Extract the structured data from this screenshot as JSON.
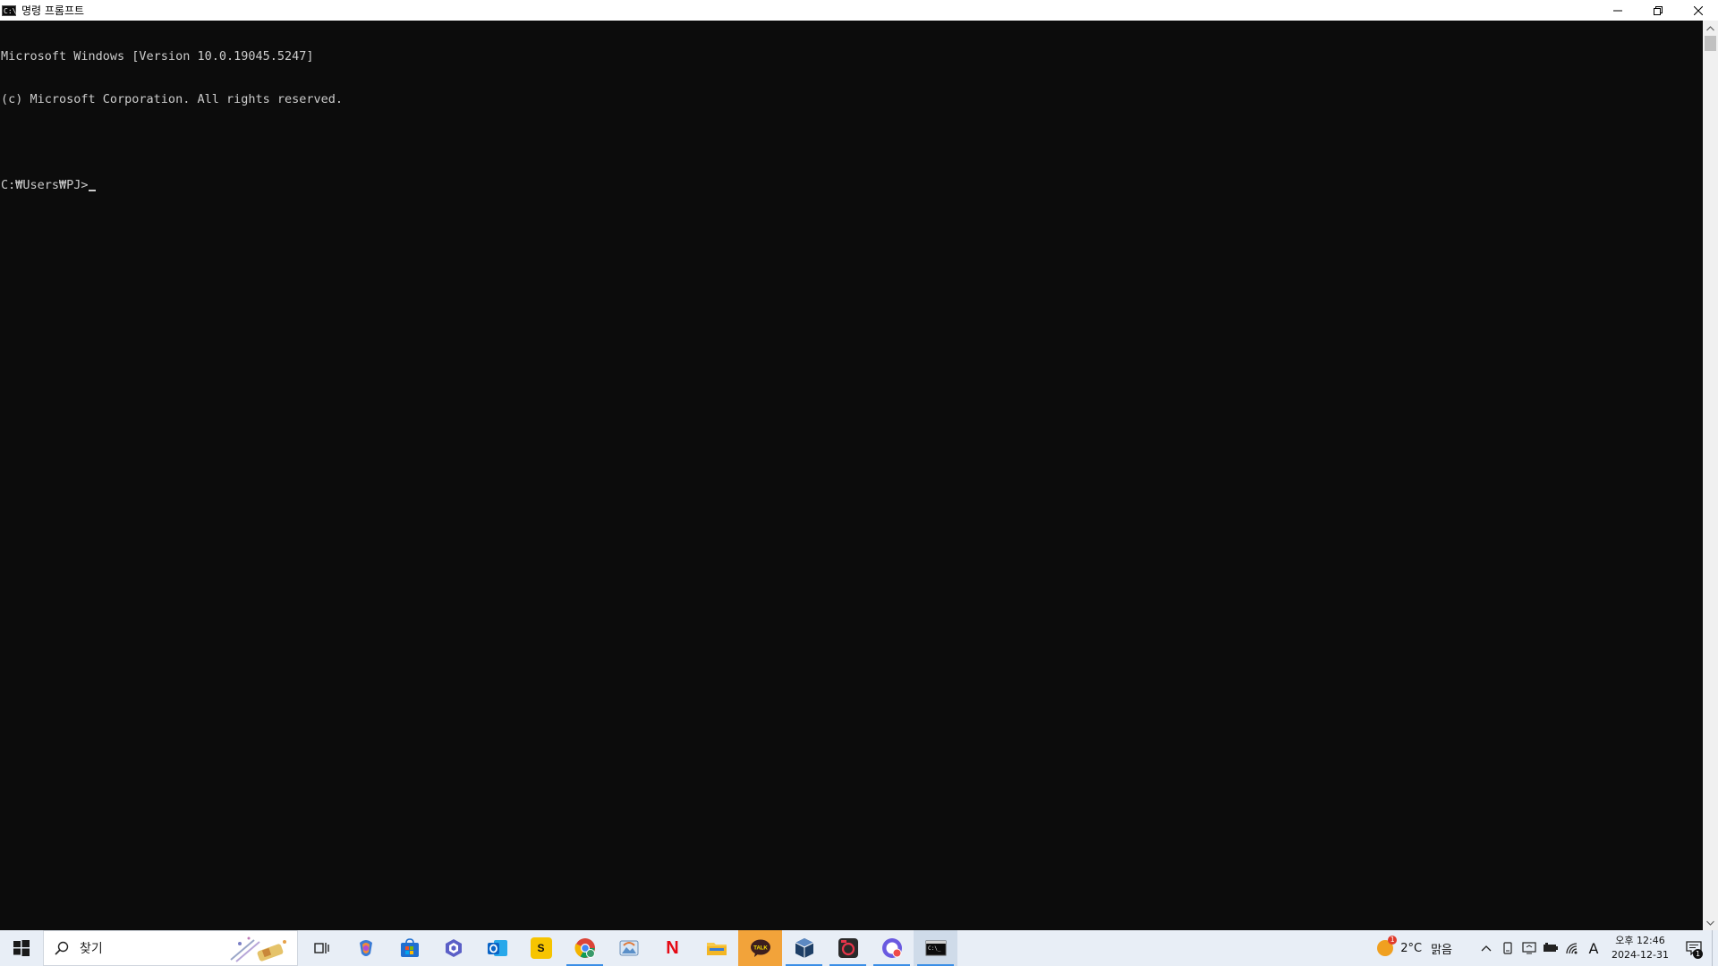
{
  "window": {
    "title": "명령 프롬프트",
    "icon": "cmd-icon",
    "controls": [
      "minimize",
      "restore",
      "close"
    ]
  },
  "console": {
    "lines": [
      "Microsoft Windows [Version 10.0.19045.5247]",
      "(c) Microsoft Corporation. All rights reserved.",
      "",
      "C:₩Users₩PJ>"
    ]
  },
  "taskbar": {
    "search_placeholder": "찾기",
    "apps": [
      {
        "name": "task-view",
        "running": false
      },
      {
        "name": "copilot",
        "running": false
      },
      {
        "name": "microsoft-store",
        "running": false
      },
      {
        "name": "teams",
        "running": false
      },
      {
        "name": "outlook",
        "running": false
      },
      {
        "name": "s-app",
        "label": "S",
        "running": false
      },
      {
        "name": "chrome",
        "running": true
      },
      {
        "name": "photos",
        "running": false
      },
      {
        "name": "netflix",
        "label": "N",
        "running": false
      },
      {
        "name": "file-explorer",
        "running": false
      },
      {
        "name": "kakaotalk",
        "label": "TALK",
        "running": false
      },
      {
        "name": "virtualbox",
        "running": true
      },
      {
        "name": "davinci-app",
        "running": true
      },
      {
        "name": "messenger",
        "running": true
      },
      {
        "name": "command-prompt",
        "running": true
      }
    ],
    "weather": {
      "temp": "2°C",
      "condition": "맑음",
      "badge": "1"
    },
    "clock": {
      "time": "오후 12:46",
      "date": "2024-12-31"
    },
    "ime": "A",
    "notification_count": "1"
  }
}
